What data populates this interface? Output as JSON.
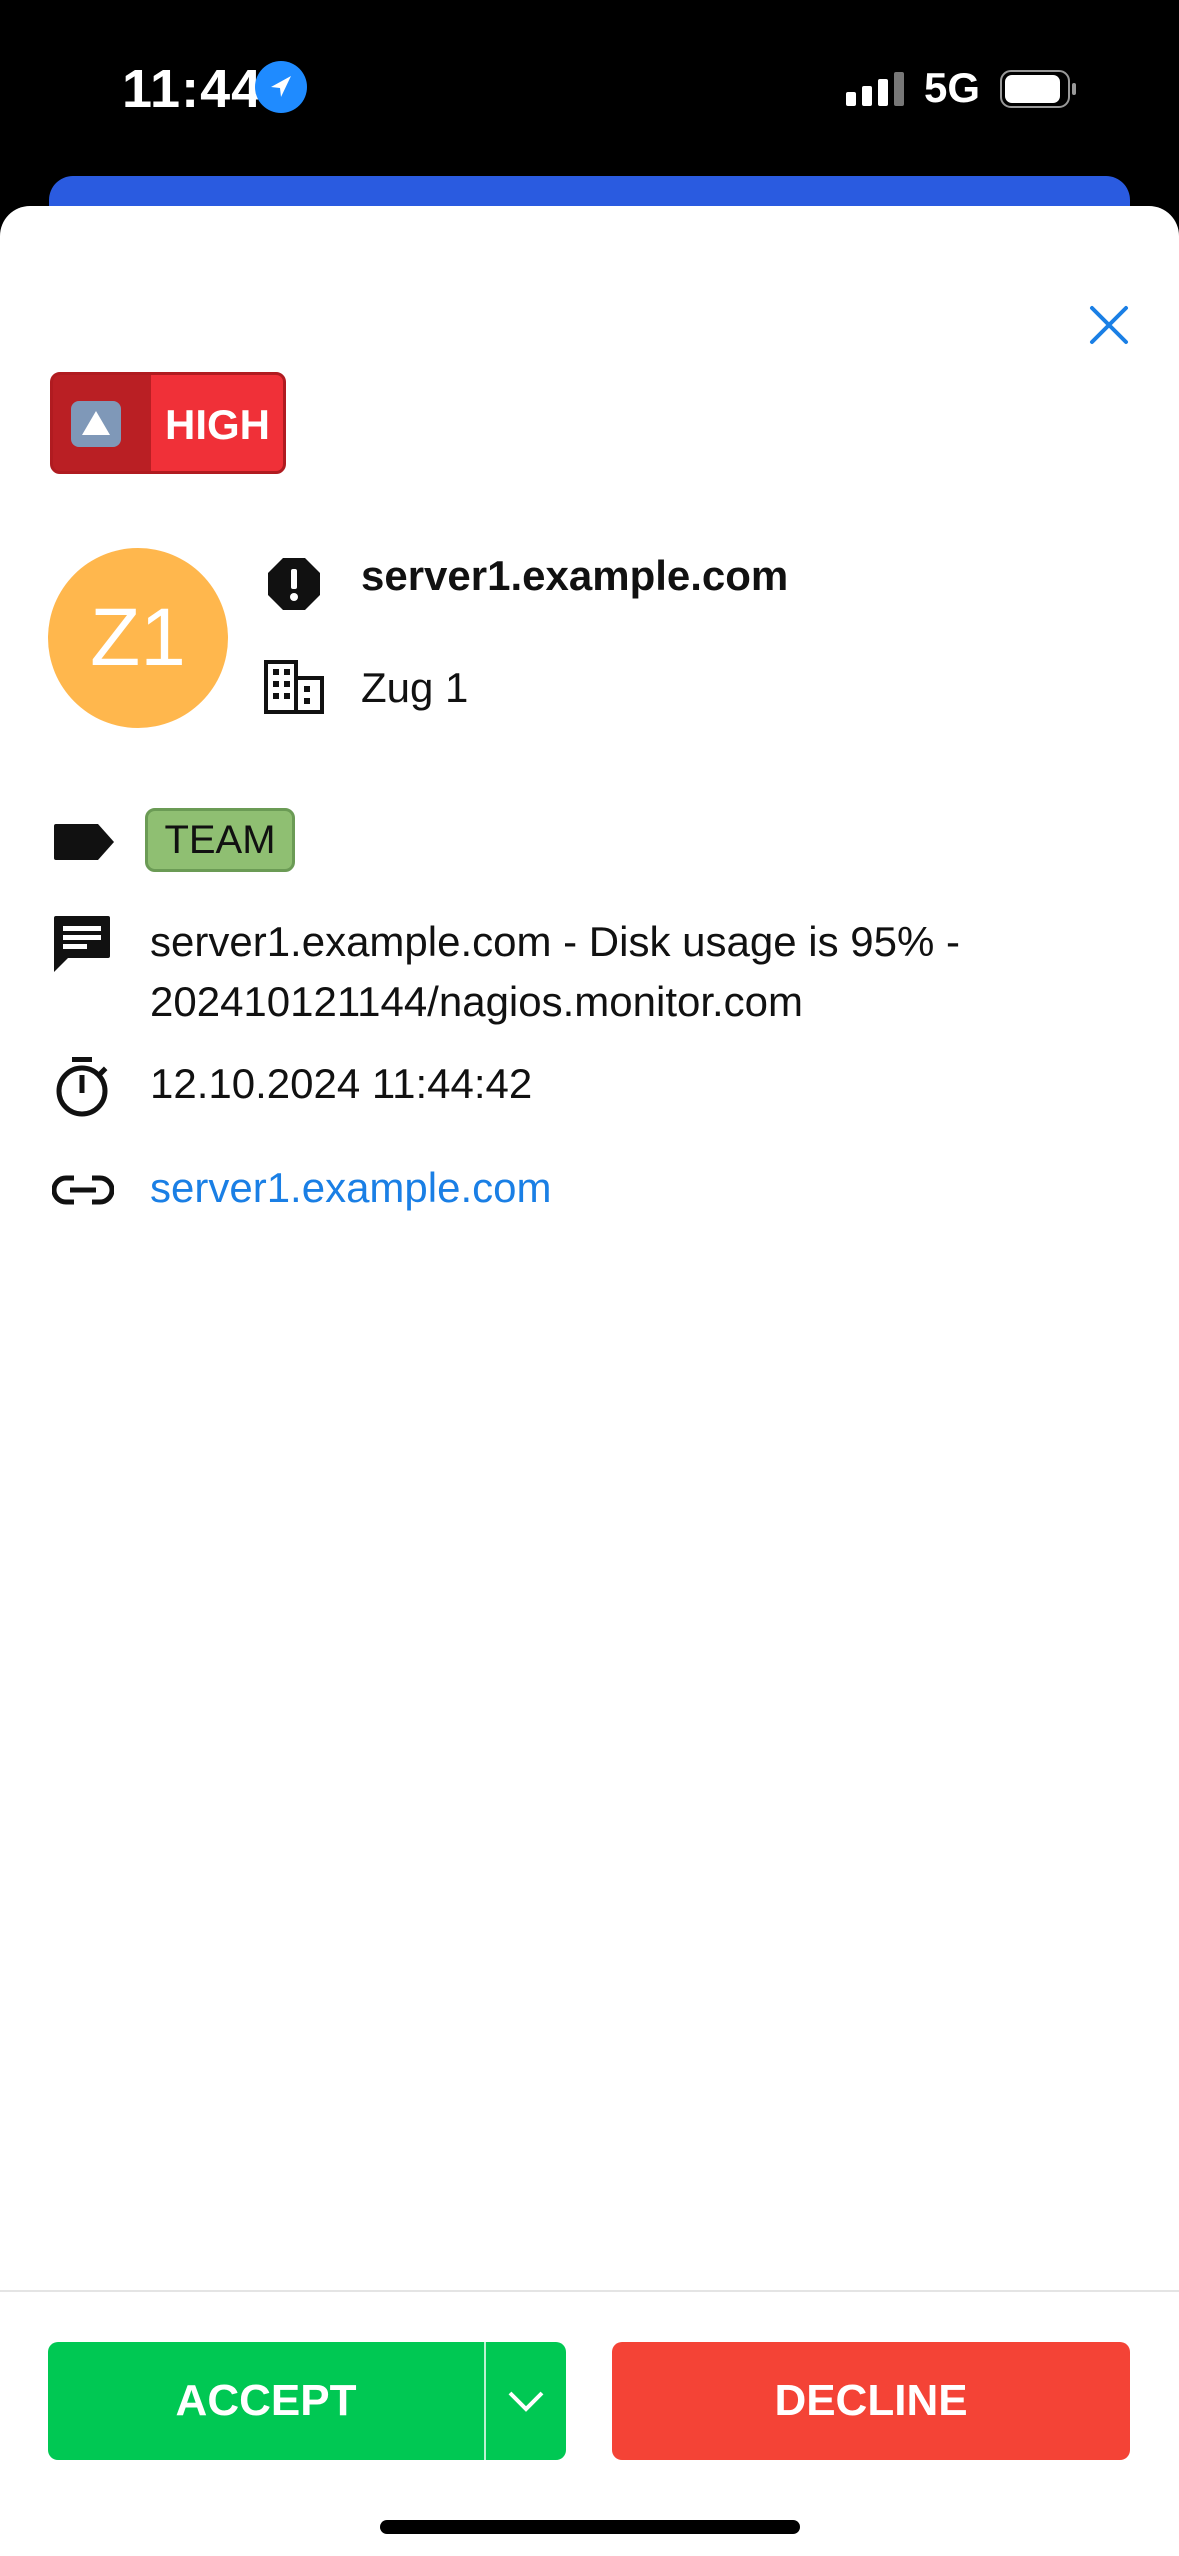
{
  "status_bar": {
    "time": "11:44",
    "network": "5G"
  },
  "alert": {
    "priority_label": "HIGH",
    "avatar_initials": "Z1",
    "host": "server1.example.com",
    "location": "Zug 1",
    "tag": "TEAM",
    "message": "server1.example.com - Disk usage is 95% - 202410121144/nagios.monitor.com",
    "timestamp": "12.10.2024 11:44:42",
    "link_text": "server1.example.com"
  },
  "actions": {
    "accept_label": "ACCEPT",
    "decline_label": "DECLINE"
  },
  "colors": {
    "accent": "#1a7fe5",
    "priority_high": "#f03038",
    "avatar": "#ffb74d",
    "tag": "#8fbf72",
    "accept": "#00c853",
    "decline": "#f44336"
  },
  "icons": [
    "location-arrow-icon",
    "signal-icon",
    "battery-icon",
    "close-icon",
    "priority-up-icon",
    "alert-octagon-icon",
    "building-icon",
    "tag-icon",
    "message-icon",
    "timer-icon",
    "link-icon",
    "chevron-down-icon"
  ]
}
